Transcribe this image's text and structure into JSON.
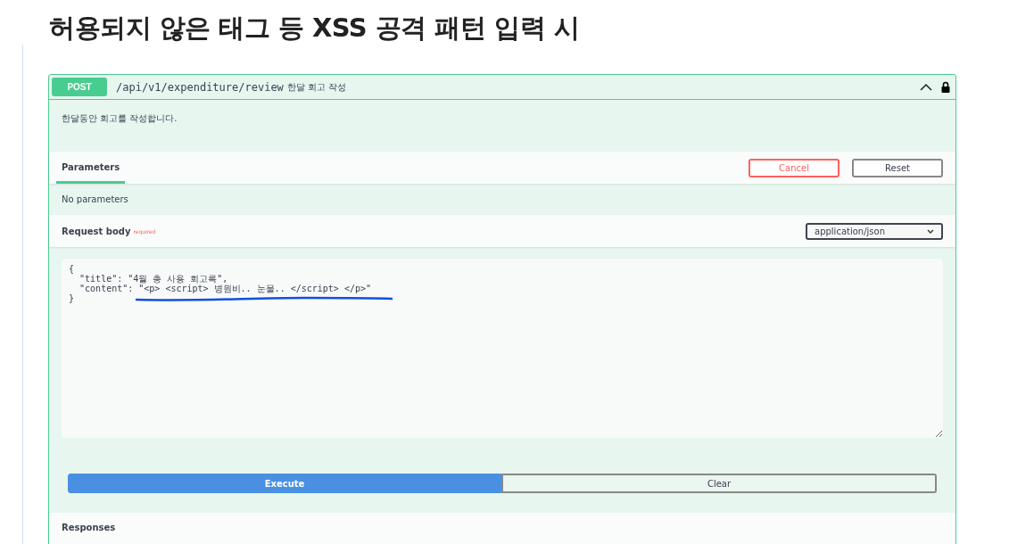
{
  "heading": "허용되지 않은 태그 등 XSS 공격 패턴 입력 시",
  "operation": {
    "method": "POST",
    "path": "/api/v1/expenditure/review",
    "summary": "한달 회고 작성",
    "expanded": true,
    "locked": true,
    "description": "한달동안 회고를 작성합니다."
  },
  "parameters": {
    "tab": "Parameters",
    "empty_text": "No parameters",
    "buttons": [
      {
        "label": "Cancel",
        "kind": "cancel"
      },
      {
        "label": "Reset",
        "kind": "reset"
      }
    ]
  },
  "request_body": {
    "label": "Request body",
    "required": "required",
    "content_type": "application/json",
    "value": "{\n  \"title\": \"4월 총 사용 회고록\",\n  \"content\": \"<p> <script> 병원비.. 눈물.. </script> </p>\"\n}"
  },
  "actions": [
    {
      "label": "Execute",
      "kind": "primary"
    },
    {
      "label": "Clear",
      "kind": "secondary"
    }
  ],
  "responses": {
    "title": "Responses"
  }
}
